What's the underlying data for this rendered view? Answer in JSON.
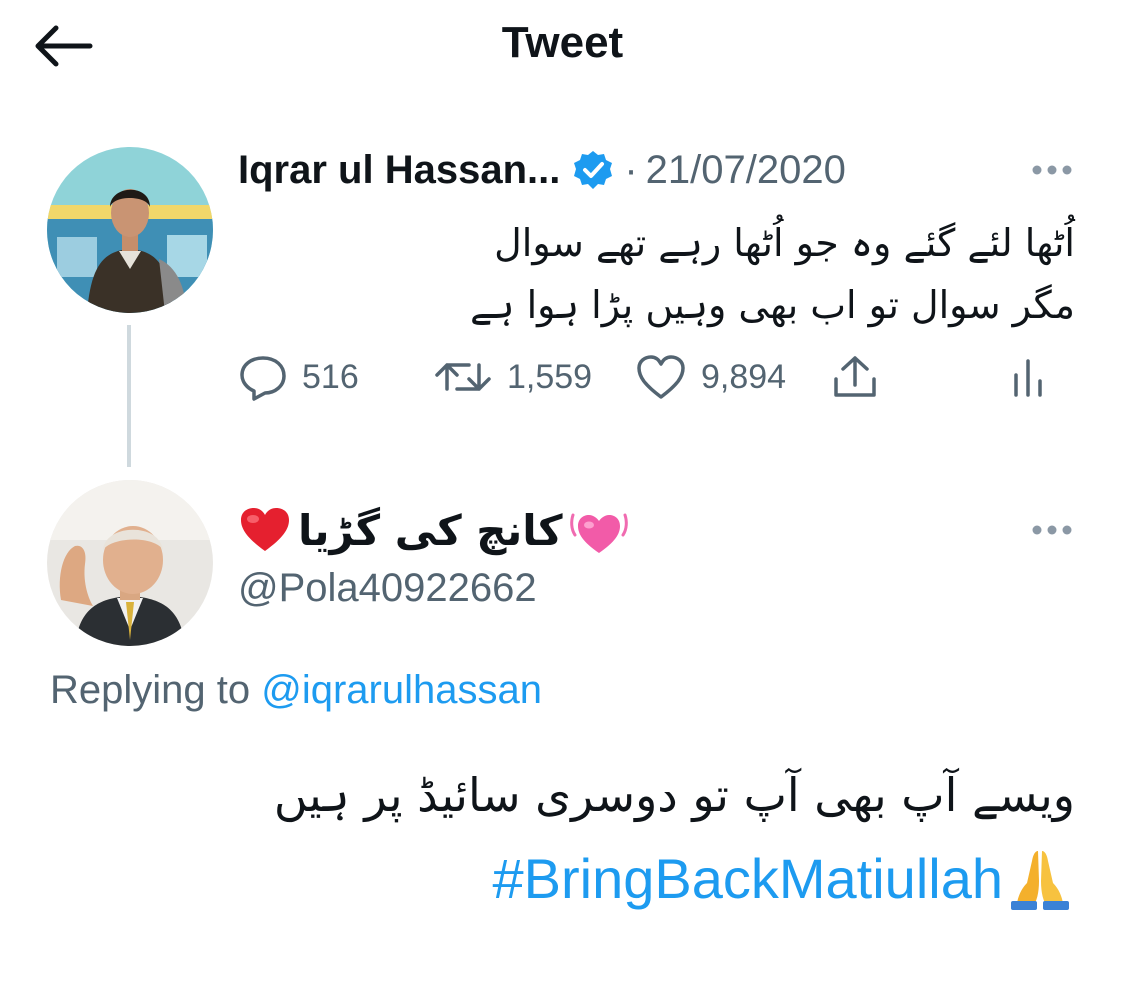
{
  "header": {
    "title": "Tweet",
    "back_icon": "arrow-left-icon"
  },
  "tweet": {
    "author_name": "Iqrar ul Hassan...",
    "verified_icon": "verified-badge-icon",
    "separator": "·",
    "date": "21/07/2020",
    "text_line1": "اُٹھا لئے گئے وہ جو اُٹھا رہے تھے سوال",
    "text_line2": "مگر سوال تو اب بھی وہیں پڑا ہوا ہے",
    "more_icon": "more-icon",
    "actions": {
      "reply_count": "516",
      "retweet_count": "1,559",
      "like_count": "9,894",
      "reply_icon": "reply-icon",
      "retweet_icon": "retweet-icon",
      "like_icon": "heart-icon",
      "share_icon": "share-icon",
      "stats_icon": "stats-icon"
    }
  },
  "reply": {
    "display_name": "کانچ کی گڑیا",
    "name_emoji_before": "heart-emoji",
    "name_emoji_after": "heart-pulse-emoji",
    "handle": "@Pola40922662",
    "more_icon": "more-icon",
    "replying_prefix": "Replying to",
    "replying_to": "@iqrarulhassan",
    "text_line1": "ویسے آپ بھی آپ تو دوسری سائیڈ پر ہیں",
    "hashtag": "#BringBackMatiullah",
    "hashtag_emoji": "folded-hands-emoji"
  },
  "colors": {
    "text": "#0f1419",
    "secondary": "#536471",
    "accent": "#1d9bf0",
    "thread_line": "#cfd9de"
  }
}
